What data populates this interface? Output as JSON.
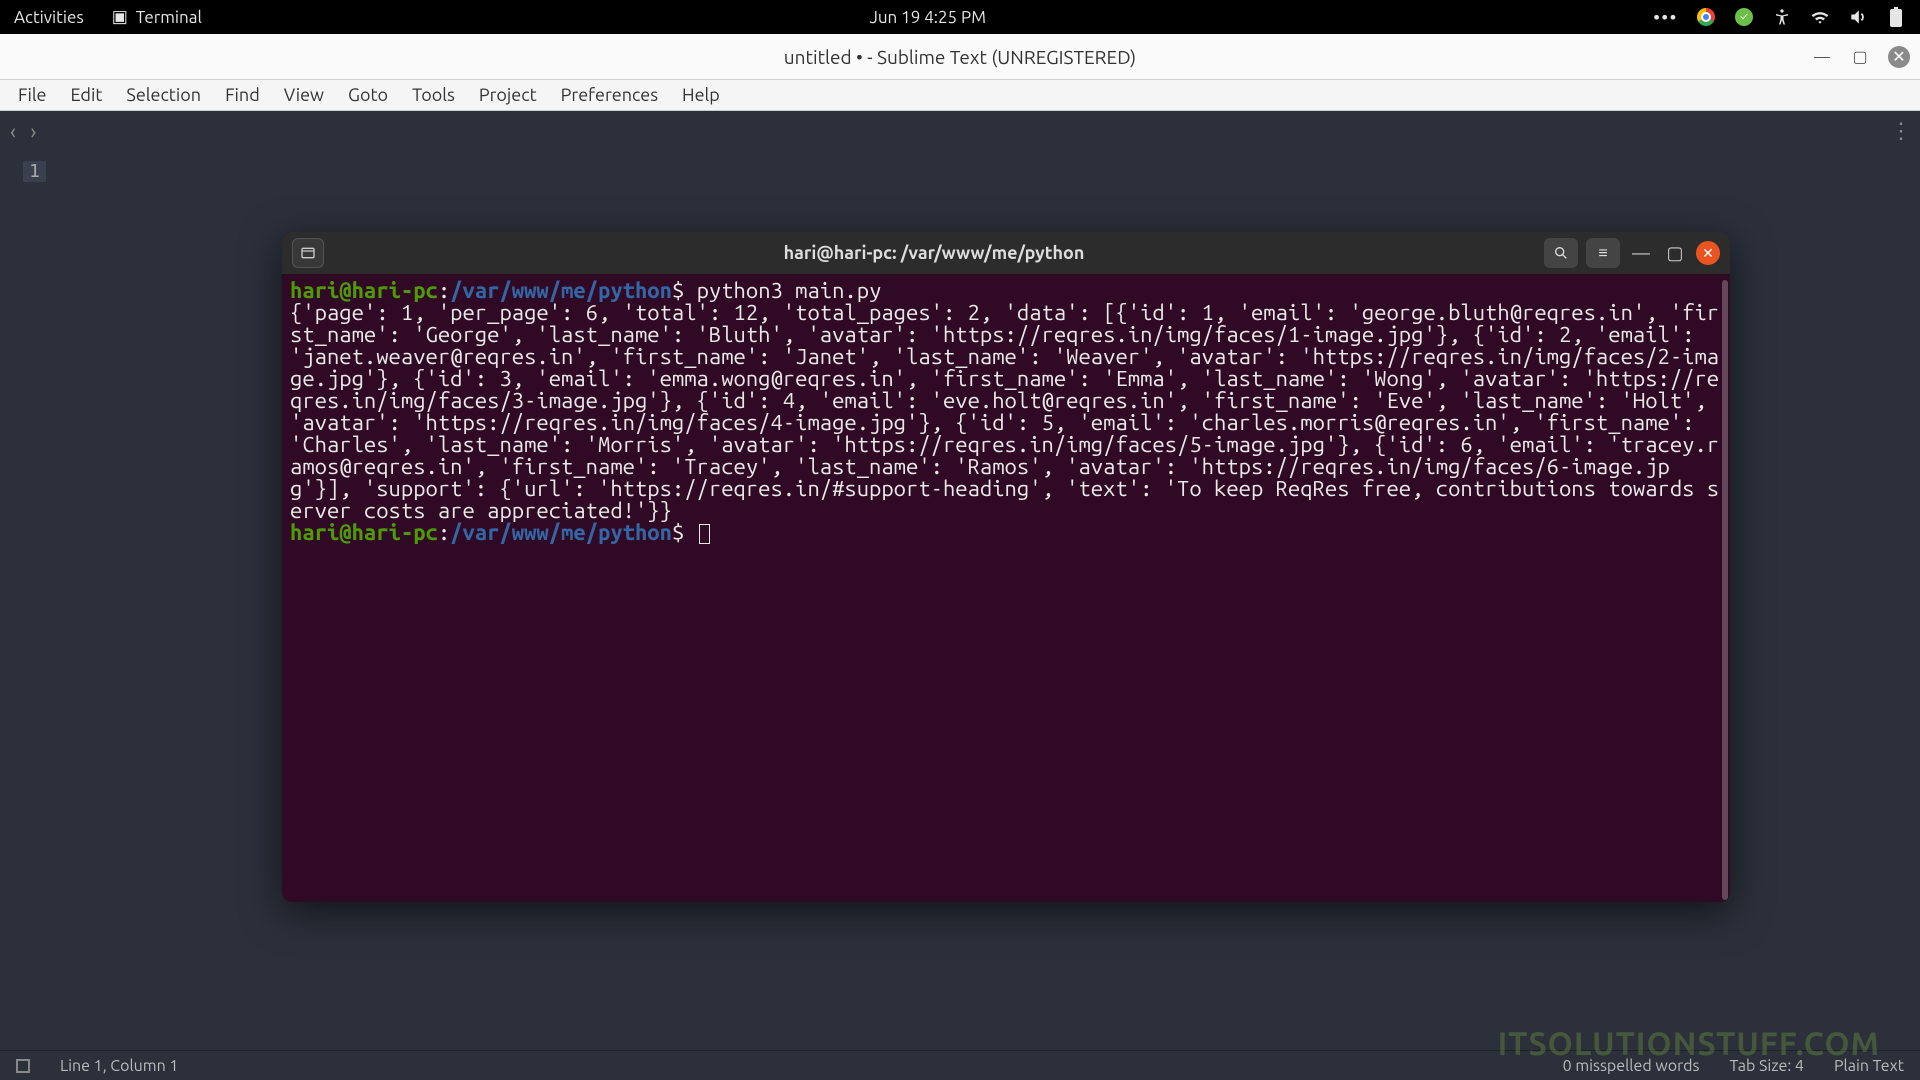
{
  "gnome": {
    "activities": "Activities",
    "app_name": "Terminal",
    "clock": "Jun 19  4:25 PM"
  },
  "sublime": {
    "title": "untitled • - Sublime Text (UNREGISTERED)",
    "menu": [
      "File",
      "Edit",
      "Selection",
      "Find",
      "View",
      "Goto",
      "Tools",
      "Project",
      "Preferences",
      "Help"
    ],
    "line_number": "1",
    "status": {
      "pos": "Line 1, Column 1",
      "spell": "0 misspelled words",
      "tab": "Tab Size: 4",
      "syntax": "Plain Text"
    }
  },
  "terminal": {
    "title": "hari@hari-pc: /var/www/me/python",
    "prompt": {
      "user": "hari",
      "host": "hari-pc",
      "path": "/var/www/me/python"
    },
    "command": "python3 main.py",
    "output": "{'page': 1, 'per_page': 6, 'total': 12, 'total_pages': 2, 'data': [{'id': 1, 'email': 'george.bluth@reqres.in', 'first_name': 'George', 'last_name': 'Bluth', 'avatar': 'https://reqres.in/img/faces/1-image.jpg'}, {'id': 2, 'email': 'janet.weaver@reqres.in', 'first_name': 'Janet', 'last_name': 'Weaver', 'avatar': 'https://reqres.in/img/faces/2-image.jpg'}, {'id': 3, 'email': 'emma.wong@reqres.in', 'first_name': 'Emma', 'last_name': 'Wong', 'avatar': 'https://reqres.in/img/faces/3-image.jpg'}, {'id': 4, 'email': 'eve.holt@reqres.in', 'first_name': 'Eve', 'last_name': 'Holt', 'avatar': 'https://reqres.in/img/faces/4-image.jpg'}, {'id': 5, 'email': 'charles.morris@reqres.in', 'first_name': 'Charles', 'last_name': 'Morris', 'avatar': 'https://reqres.in/img/faces/5-image.jpg'}, {'id': 6, 'email': 'tracey.ramos@reqres.in', 'first_name': 'Tracey', 'last_name': 'Ramos', 'avatar': 'https://reqres.in/img/faces/6-image.jpg'}], 'support': {'url': 'https://reqres.in/#support-heading', 'text': 'To keep ReqRes free, contributions towards server costs are appreciated!'}}"
  },
  "watermark": "ITSOLUTIONSTUFF.COM"
}
